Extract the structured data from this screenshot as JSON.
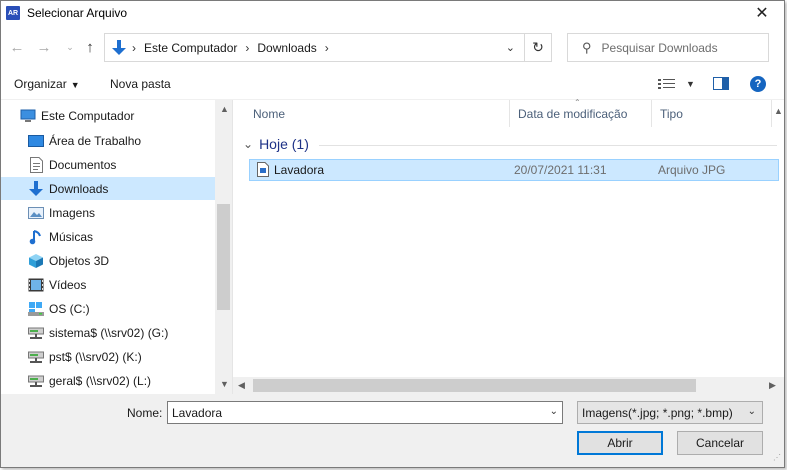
{
  "window": {
    "title": "Selecionar Arquivo",
    "app_icon_text": "AR"
  },
  "nav": {
    "breadcrumb": [
      "Este Computador",
      "Downloads"
    ],
    "search_placeholder": "Pesquisar Downloads"
  },
  "toolbar": {
    "organize": "Organizar",
    "new_folder": "Nova pasta"
  },
  "tree": {
    "items": [
      {
        "label": "Este Computador",
        "icon": "computer-icon"
      },
      {
        "label": "Área de Trabalho",
        "icon": "desktop-icon"
      },
      {
        "label": "Documentos",
        "icon": "documents-icon"
      },
      {
        "label": "Downloads",
        "icon": "download-icon",
        "selected": true
      },
      {
        "label": "Imagens",
        "icon": "pictures-icon"
      },
      {
        "label": "Músicas",
        "icon": "music-icon"
      },
      {
        "label": "Objetos 3D",
        "icon": "objects-3d-icon"
      },
      {
        "label": "Vídeos",
        "icon": "videos-icon"
      },
      {
        "label": "OS (C:)",
        "icon": "drive-icon"
      },
      {
        "label": "sistema$ (\\\\srv02) (G:)",
        "icon": "network-drive-icon"
      },
      {
        "label": "pst$ (\\\\srv02) (K:)",
        "icon": "network-drive-icon"
      },
      {
        "label": "geral$ (\\\\srv02) (L:)",
        "icon": "network-drive-icon"
      }
    ]
  },
  "filelist": {
    "columns": [
      "Nome",
      "Data de modificação",
      "Tipo"
    ],
    "group": "Hoje (1)",
    "files": [
      {
        "name": "Lavadora",
        "modified": "20/07/2021 11:31",
        "type": "Arquivo JPG",
        "selected": true
      }
    ]
  },
  "bottom": {
    "name_label": "Nome:",
    "name_value": "Lavadora",
    "filter": "Imagens(*.jpg; *.png; *.bmp)",
    "open_button": "Abrir",
    "cancel_button": "Cancelar"
  },
  "colors": {
    "selection": "#cce8ff",
    "accent": "#0078d7",
    "group_header": "#1e3287"
  }
}
